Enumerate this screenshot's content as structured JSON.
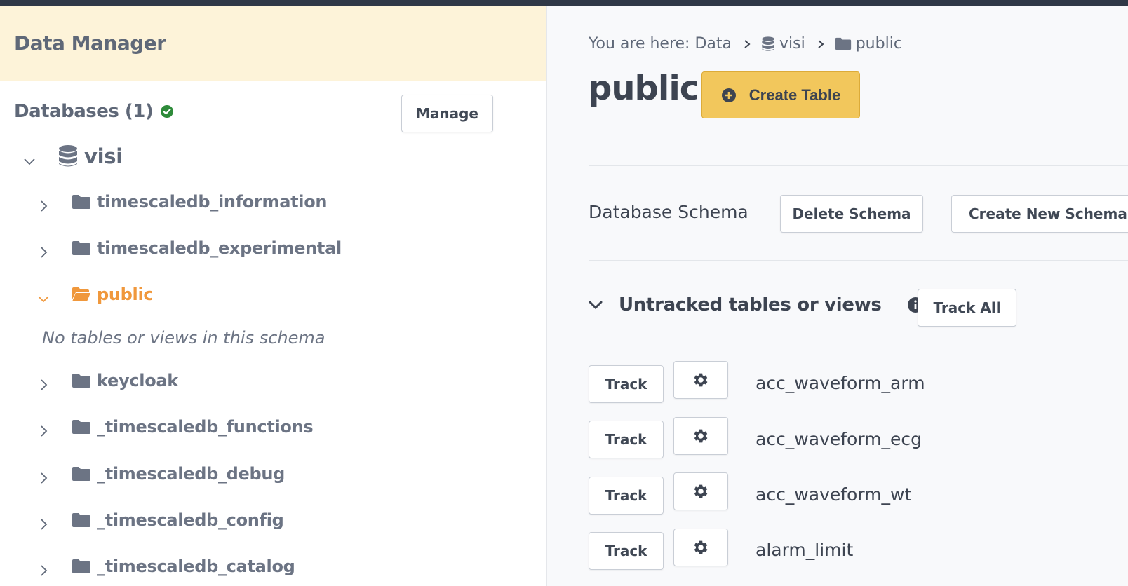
{
  "sidebar": {
    "title": "Data Manager",
    "databases_heading": "Databases (1)",
    "manage_label": "Manage",
    "root_db": "visi",
    "schemas": [
      {
        "name": "timescaledb_information",
        "expanded": false
      },
      {
        "name": "timescaledb_experimental",
        "expanded": false
      },
      {
        "name": "public",
        "expanded": true,
        "active": true
      },
      {
        "name": "keycloak",
        "expanded": false
      },
      {
        "name": "_timescaledb_functions",
        "expanded": false
      },
      {
        "name": "_timescaledb_debug",
        "expanded": false
      },
      {
        "name": "_timescaledb_config",
        "expanded": false
      },
      {
        "name": "_timescaledb_catalog",
        "expanded": false
      }
    ],
    "empty_note": "No tables or views in this schema",
    "colors": {
      "active": "#f0983c",
      "status_ok": "#2e8b3a"
    }
  },
  "main": {
    "breadcrumb": {
      "prefix": "You are here: Data",
      "database": "visi",
      "schema": "public"
    },
    "title": "public",
    "create_table_label": "Create Table",
    "schema_label": "Database Schema",
    "delete_schema_label": "Delete Schema",
    "create_schema_label": "Create New Schema",
    "untracked_title": "Untracked tables or views",
    "track_all_label": "Track All",
    "track_label": "Track",
    "tables": [
      "acc_waveform_arm",
      "acc_waveform_ecg",
      "acc_waveform_wt",
      "alarm_limit"
    ],
    "colors": {
      "primary": "#f2c75c"
    }
  }
}
